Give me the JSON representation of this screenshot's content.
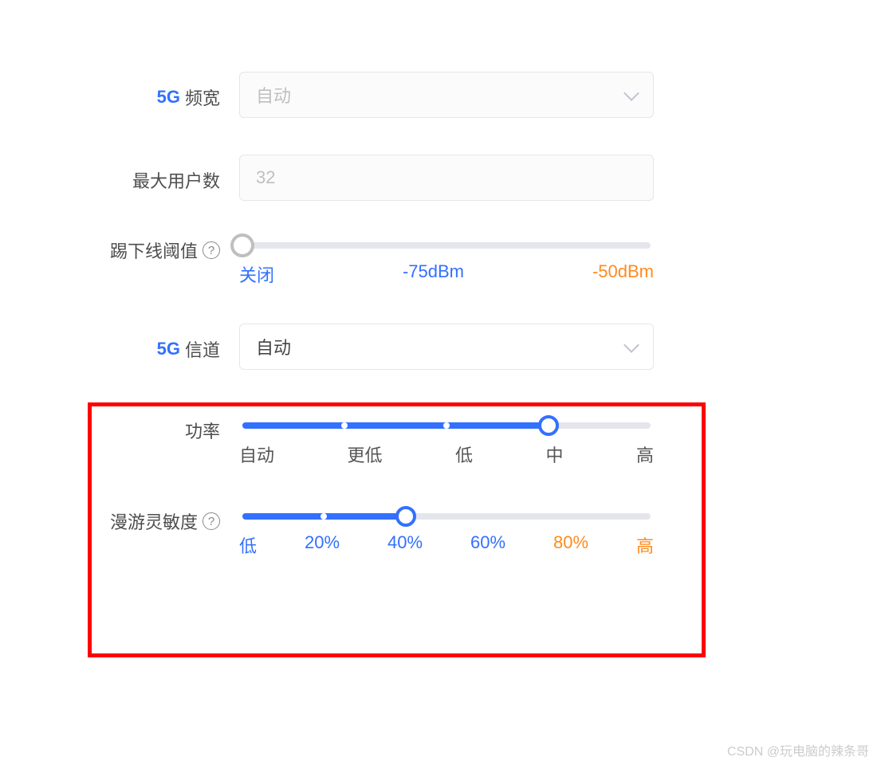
{
  "bandwidth": {
    "prefix": "5G",
    "label": "频宽",
    "value": "自动"
  },
  "maxUsers": {
    "label": "最大用户数",
    "value": "32"
  },
  "kickThreshold": {
    "label": "踢下线阈值",
    "helpGlyph": "?",
    "ticks": [
      "关闭",
      "-75dBm",
      "-50dBm"
    ],
    "pos": 0,
    "fillPercent": 0
  },
  "channel": {
    "prefix": "5G",
    "label": "信道",
    "value": "自动"
  },
  "power": {
    "label": "功率",
    "ticks": [
      "自动",
      "更低",
      "低",
      "中",
      "高"
    ],
    "pos": 3,
    "fillPercent": 75
  },
  "roaming": {
    "label": "漫游灵敏度",
    "helpGlyph": "?",
    "ticks": [
      "低",
      "20%",
      "40%",
      "60%",
      "80%",
      "高"
    ],
    "pos": 2,
    "fillPercent": 40
  },
  "watermark": "CSDN @玩电脑的辣条哥"
}
